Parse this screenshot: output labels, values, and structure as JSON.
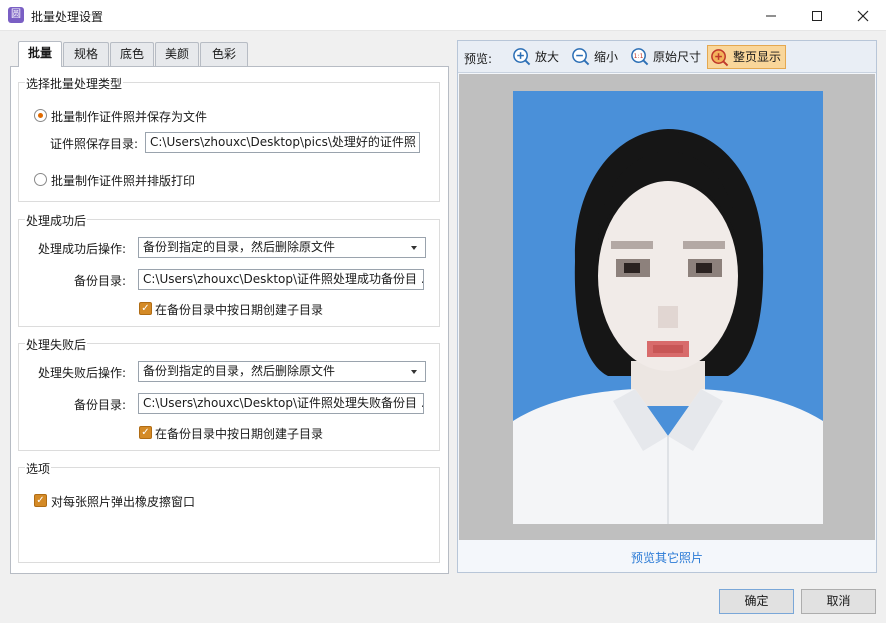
{
  "window": {
    "title": "批量处理设置",
    "app_icon_glyph": "圆"
  },
  "tabs": [
    {
      "label": "批量",
      "active": true
    },
    {
      "label": "规格",
      "active": false
    },
    {
      "label": "底色",
      "active": false
    },
    {
      "label": "美颜",
      "active": false
    },
    {
      "label": "色彩",
      "active": false
    }
  ],
  "batch_type": {
    "title": "选择批量处理类型",
    "option_save": "批量制作证件照并保存为文件",
    "save_dir_label": "证件照保存目录:",
    "save_dir_value": "C:\\Users\\zhouxc\\Desktop\\pics\\处理好的证件照 ...",
    "option_print": "批量制作证件照并排版打印",
    "selected": "save"
  },
  "on_success": {
    "title": "处理成功后",
    "action_label": "处理成功后操作:",
    "action_value": "备份到指定的目录，然后删除原文件",
    "backup_label": "备份目录:",
    "backup_value": "C:\\Users\\zhouxc\\Desktop\\证件照处理成功备份目 ...",
    "date_subdir_label": "在备份目录中按日期创建子目录",
    "date_subdir_checked": true
  },
  "on_failure": {
    "title": "处理失败后",
    "action_label": "处理失败后操作:",
    "action_value": "备份到指定的目录，然后删除原文件",
    "backup_label": "备份目录:",
    "backup_value": "C:\\Users\\zhouxc\\Desktop\\证件照处理失败备份目 ...",
    "date_subdir_label": "在备份目录中按日期创建子目录",
    "date_subdir_checked": true
  },
  "options": {
    "title": "选项",
    "eraser_popup_label": "对每张照片弹出橡皮擦窗口",
    "eraser_popup_checked": true
  },
  "preview": {
    "label": "预览:",
    "zoom_in": "放大",
    "zoom_out": "缩小",
    "original_size": "原始尺寸",
    "original_size_icon_text": "1:1",
    "fit_page": "整页显示",
    "more_photos_link": "预览其它照片",
    "photo_background_color": "#4a90d9"
  },
  "buttons": {
    "ok": "确定",
    "cancel": "取消"
  }
}
